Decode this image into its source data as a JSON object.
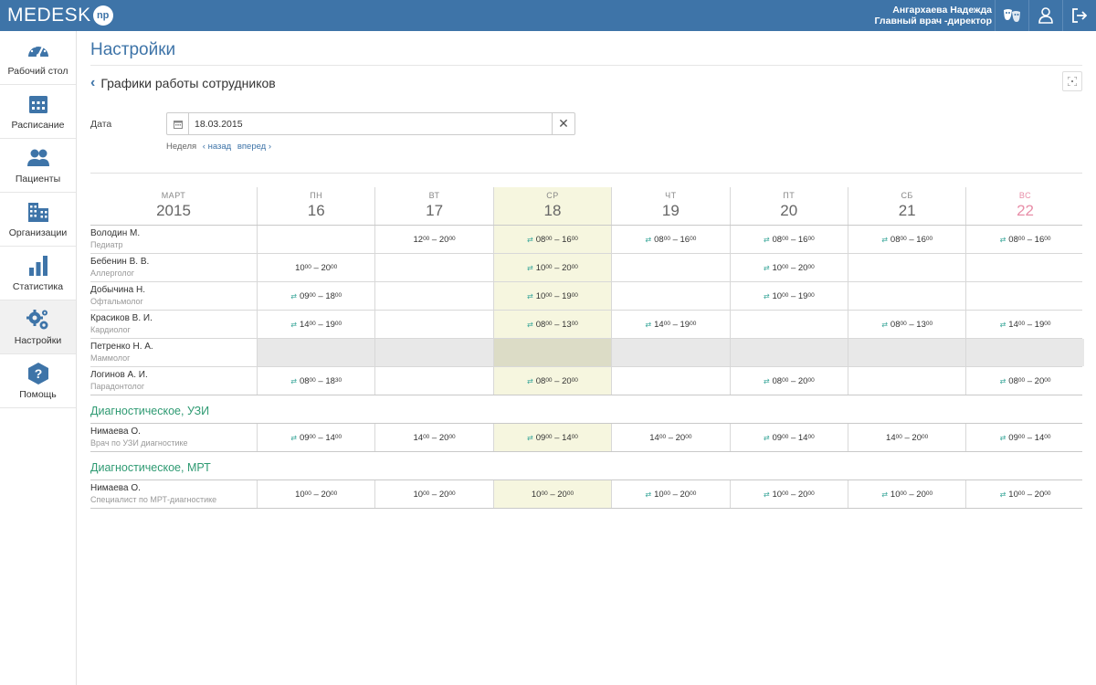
{
  "app": {
    "logo_text": "MEDESK",
    "logo_badge": "np",
    "user_name": "Ангархаева Надежда",
    "user_role": "Главный врач -директор"
  },
  "sidebar": {
    "items": [
      {
        "label": "Рабочий стол",
        "icon": "dashboard-icon"
      },
      {
        "label": "Расписание",
        "icon": "calendar-icon"
      },
      {
        "label": "Пациенты",
        "icon": "users-icon"
      },
      {
        "label": "Организации",
        "icon": "buildings-icon"
      },
      {
        "label": "Статистика",
        "icon": "bar-chart-icon"
      },
      {
        "label": "Настройки",
        "icon": "gears-icon",
        "active": true
      },
      {
        "label": "Помощь",
        "icon": "help-icon"
      }
    ]
  },
  "page": {
    "title": "Настройки",
    "subtitle": "Графики работы сотрудников"
  },
  "filter": {
    "date_label": "Дата",
    "date_value": "18.03.2015",
    "week_label": "Неделя",
    "back_label": "назад",
    "forward_label": "вперед"
  },
  "calendar": {
    "month": "МАРТ",
    "year": "2015",
    "days": [
      {
        "dow": "ПН",
        "num": "16"
      },
      {
        "dow": "ВТ",
        "num": "17"
      },
      {
        "dow": "СР",
        "num": "18",
        "today": true
      },
      {
        "dow": "ЧТ",
        "num": "19"
      },
      {
        "dow": "ПТ",
        "num": "20"
      },
      {
        "dow": "СБ",
        "num": "21"
      },
      {
        "dow": "ВС",
        "num": "22",
        "sunday": true
      }
    ]
  },
  "groups": [
    {
      "title": "",
      "employees": [
        {
          "name": "Володин М.",
          "role": "Педиатр",
          "shifts": [
            null,
            {
              "s": "12",
              "sm": "00",
              "e": "20",
              "em": "00",
              "sw": false
            },
            {
              "s": "08",
              "sm": "00",
              "e": "16",
              "em": "00",
              "sw": true
            },
            {
              "s": "08",
              "sm": "00",
              "e": "16",
              "em": "00",
              "sw": true
            },
            {
              "s": "08",
              "sm": "00",
              "e": "16",
              "em": "00",
              "sw": true
            },
            {
              "s": "08",
              "sm": "00",
              "e": "16",
              "em": "00",
              "sw": true
            },
            {
              "s": "08",
              "sm": "00",
              "e": "16",
              "em": "00",
              "sw": true
            }
          ]
        },
        {
          "name": "Бебенин В. В.",
          "role": "Аллерголог",
          "shifts": [
            {
              "s": "10",
              "sm": "00",
              "e": "20",
              "em": "00",
              "sw": false
            },
            null,
            {
              "s": "10",
              "sm": "00",
              "e": "20",
              "em": "00",
              "sw": true
            },
            null,
            {
              "s": "10",
              "sm": "00",
              "e": "20",
              "em": "00",
              "sw": true
            },
            null,
            null
          ]
        },
        {
          "name": "Добычина Н.",
          "role": "Офтальмолог",
          "shifts": [
            {
              "s": "09",
              "sm": "00",
              "e": "18",
              "em": "00",
              "sw": true
            },
            null,
            {
              "s": "10",
              "sm": "00",
              "e": "19",
              "em": "00",
              "sw": true
            },
            null,
            {
              "s": "10",
              "sm": "00",
              "e": "19",
              "em": "00",
              "sw": true
            },
            null,
            null
          ]
        },
        {
          "name": "Красиков В. И.",
          "role": "Кардиолог",
          "shifts": [
            {
              "s": "14",
              "sm": "00",
              "e": "19",
              "em": "00",
              "sw": true
            },
            null,
            {
              "s": "08",
              "sm": "00",
              "e": "13",
              "em": "00",
              "sw": true
            },
            {
              "s": "14",
              "sm": "00",
              "e": "19",
              "em": "00",
              "sw": true
            },
            null,
            {
              "s": "08",
              "sm": "00",
              "e": "13",
              "em": "00",
              "sw": true
            },
            {
              "s": "14",
              "sm": "00",
              "e": "19",
              "em": "00",
              "sw": true
            }
          ]
        },
        {
          "name": "Петренко Н. А.",
          "role": "Маммолог",
          "disabled": true,
          "shifts": [
            null,
            null,
            null,
            null,
            null,
            null,
            null
          ]
        },
        {
          "name": "Логинов А. И.",
          "role": "Парадонтолог",
          "shifts": [
            {
              "s": "08",
              "sm": "00",
              "e": "18",
              "em": "30",
              "sw": true
            },
            null,
            {
              "s": "08",
              "sm": "00",
              "e": "20",
              "em": "00",
              "sw": true
            },
            null,
            {
              "s": "08",
              "sm": "00",
              "e": "20",
              "em": "00",
              "sw": true
            },
            null,
            {
              "s": "08",
              "sm": "00",
              "e": "20",
              "em": "00",
              "sw": true
            }
          ]
        }
      ]
    },
    {
      "title": "Диагностическое, УЗИ",
      "employees": [
        {
          "name": "Нимаева О.",
          "role": "Врач по УЗИ диагностике",
          "shifts": [
            {
              "s": "09",
              "sm": "00",
              "e": "14",
              "em": "00",
              "sw": true
            },
            {
              "s": "14",
              "sm": "00",
              "e": "20",
              "em": "00",
              "sw": false
            },
            {
              "s": "09",
              "sm": "00",
              "e": "14",
              "em": "00",
              "sw": true
            },
            {
              "s": "14",
              "sm": "00",
              "e": "20",
              "em": "00",
              "sw": false
            },
            {
              "s": "09",
              "sm": "00",
              "e": "14",
              "em": "00",
              "sw": true
            },
            {
              "s": "14",
              "sm": "00",
              "e": "20",
              "em": "00",
              "sw": false
            },
            {
              "s": "09",
              "sm": "00",
              "e": "14",
              "em": "00",
              "sw": true
            }
          ]
        }
      ]
    },
    {
      "title": "Диагностическое, МРТ",
      "employees": [
        {
          "name": "Нимаева О.",
          "role": "Специалист по МРТ-диагностике",
          "shifts": [
            {
              "s": "10",
              "sm": "00",
              "e": "20",
              "em": "00",
              "sw": false
            },
            {
              "s": "10",
              "sm": "00",
              "e": "20",
              "em": "00",
              "sw": false
            },
            {
              "s": "10",
              "sm": "00",
              "e": "20",
              "em": "00",
              "sw": false
            },
            {
              "s": "10",
              "sm": "00",
              "e": "20",
              "em": "00",
              "sw": true
            },
            {
              "s": "10",
              "sm": "00",
              "e": "20",
              "em": "00",
              "sw": true
            },
            {
              "s": "10",
              "sm": "00",
              "e": "20",
              "em": "00",
              "sw": true
            },
            {
              "s": "10",
              "sm": "00",
              "e": "20",
              "em": "00",
              "sw": true
            }
          ]
        }
      ]
    }
  ],
  "colors": {
    "brand": "#3e74a8",
    "today_bg": "#f6f6df",
    "section_title": "#2e9a72",
    "sunday": "#e88ea8",
    "swap_icon": "#3aa79a"
  }
}
